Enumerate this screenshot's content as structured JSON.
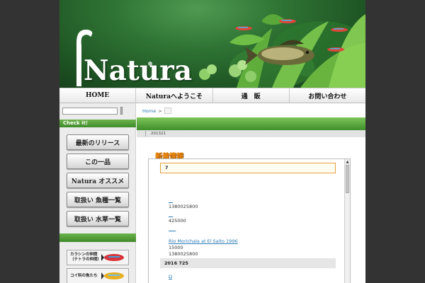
{
  "header": {
    "logo_text": "Natura"
  },
  "nav": [
    "HOME",
    "Naturaへようこそ",
    "通　販",
    "お問い合わせ"
  ],
  "sidebar": {
    "search_placeholder": "",
    "check_label": "Check it！",
    "buttons": [
      "最新のリリース",
      "この一品",
      "Natura オススメ",
      "取扱い 魚種一覧",
      "取扱い 水草一覧"
    ],
    "thumbs": [
      {
        "line1": "カラシンの仲間",
        "line2": "（テトラの仲間）"
      },
      {
        "line1": "コイ科の魚たち",
        "line2": ""
      }
    ]
  },
  "main": {
    "breadcrumb_home": "Home",
    "breadcrumb_sep": ">",
    "date": "201321",
    "section_title": "新着情報",
    "highlight": "7",
    "entries": [
      {
        "link": "",
        "lines": [
          "1380025800"
        ]
      },
      {
        "link": "",
        "lines": [
          "425000"
        ]
      },
      {
        "link": "",
        "lines": []
      },
      {
        "link": "Rio Morichala at El Salto 1996",
        "lines": [
          "15000",
          "1380025800"
        ]
      }
    ],
    "gray_heading": "2016 725",
    "last_link": "Ω"
  },
  "colors": {
    "accent_green": "#3f8f2b",
    "title_orange": "#f08a10",
    "link_blue": "#2a7ab5"
  },
  "icons": [
    "fish-icon"
  ]
}
